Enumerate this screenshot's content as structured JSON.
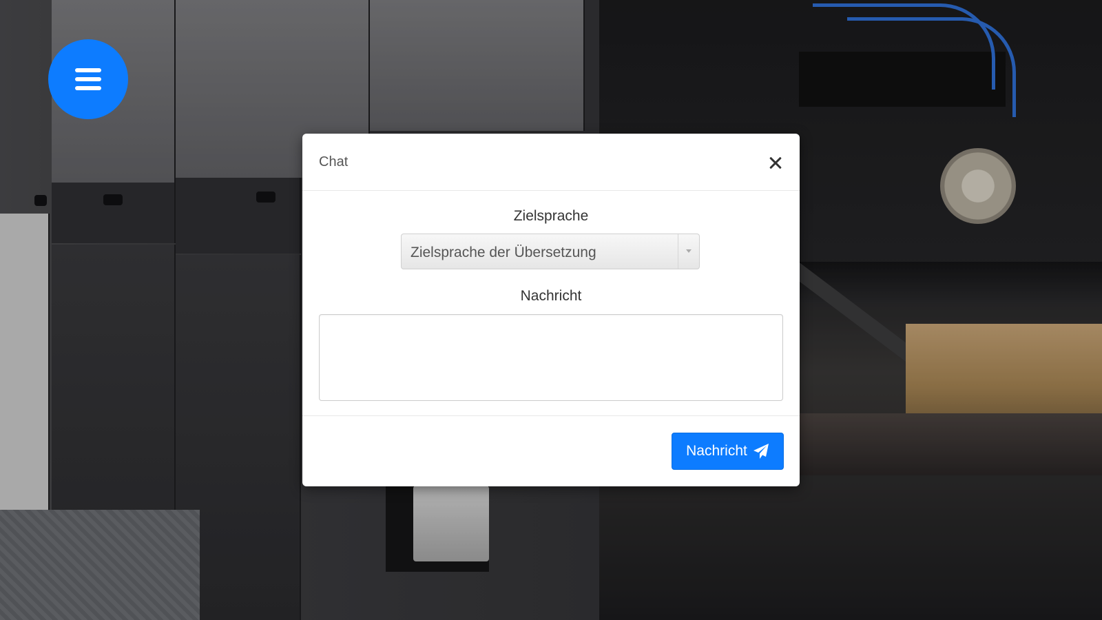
{
  "menu": {
    "icon": "hamburger-menu-icon"
  },
  "modal": {
    "title": "Chat",
    "close_icon": "close-icon",
    "language": {
      "label": "Zielsprache",
      "selected_value": "Zielsprache der Übersetzung"
    },
    "message": {
      "label": "Nachricht",
      "value": ""
    },
    "send_button": {
      "label": "Nachricht",
      "icon": "paper-plane-icon"
    }
  },
  "colors": {
    "accent": "#0d7cff",
    "modal_background": "#ffffff"
  }
}
